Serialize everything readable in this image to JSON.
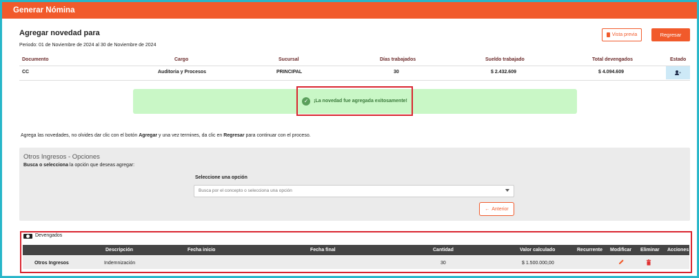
{
  "header": {
    "title": "Generar Nómina"
  },
  "page": {
    "title": "Agregar novedad para",
    "period": "Periodo: 01 de Noviembre de 2024 al 30 de Noviembre de 2024",
    "vista_previa_label": "Vista previa",
    "regresar_label": "Regresar"
  },
  "employee_table": {
    "headers": [
      "Documento",
      "Cargo",
      "Sucursal",
      "Días trabajados",
      "Sueldo trabajado",
      "Total devengados",
      "Estado"
    ],
    "row": {
      "documento": "CC",
      "cargo": "Auditoria y Procesos",
      "sucursal": "PRINCIPAL",
      "dias": "30",
      "sueldo": "$ 2.432.609",
      "total": "$ 4.094.609"
    }
  },
  "alert": {
    "message": "¡La novedad fue agregada exitosamente!"
  },
  "instructions": {
    "part1": "Agrega las novedades, no olvides dar clic con el botón ",
    "bold1": "Agregar",
    "part2": " y una vez termines, da clic en ",
    "bold2": "Regresar",
    "part3": " para continuar con el proceso."
  },
  "otros": {
    "title": "Otros Ingresos - Opciones",
    "sub_bold": "Busca o selecciona",
    "sub_rest": " la opción que deseas agregar:",
    "select_label": "Seleccione una opción",
    "select_placeholder": "Busca por el concepto o selecciona una opción",
    "anterior_label": "Anterior"
  },
  "devengados": {
    "label": "Devengados",
    "headers": {
      "descripcion": "Descripción",
      "fecha_inicio": "Fecha inicio",
      "fecha_final": "Fecha final",
      "cantidad": "Cantidad",
      "valor": "Valor calculado",
      "recurrente": "Recurrente",
      "modificar": "Modificar",
      "eliminar": "Eliminar",
      "acciones": "Acciones"
    },
    "row": {
      "concepto": "Otros Ingresos",
      "descripcion": "Indemnización",
      "cantidad": "30",
      "valor": "$ 1.500.000,00"
    }
  },
  "colors": {
    "brand": "#f15a2b",
    "success_bg": "#c9f7c6",
    "highlight_border": "#d9232e",
    "frame_border": "#27b6c9"
  }
}
